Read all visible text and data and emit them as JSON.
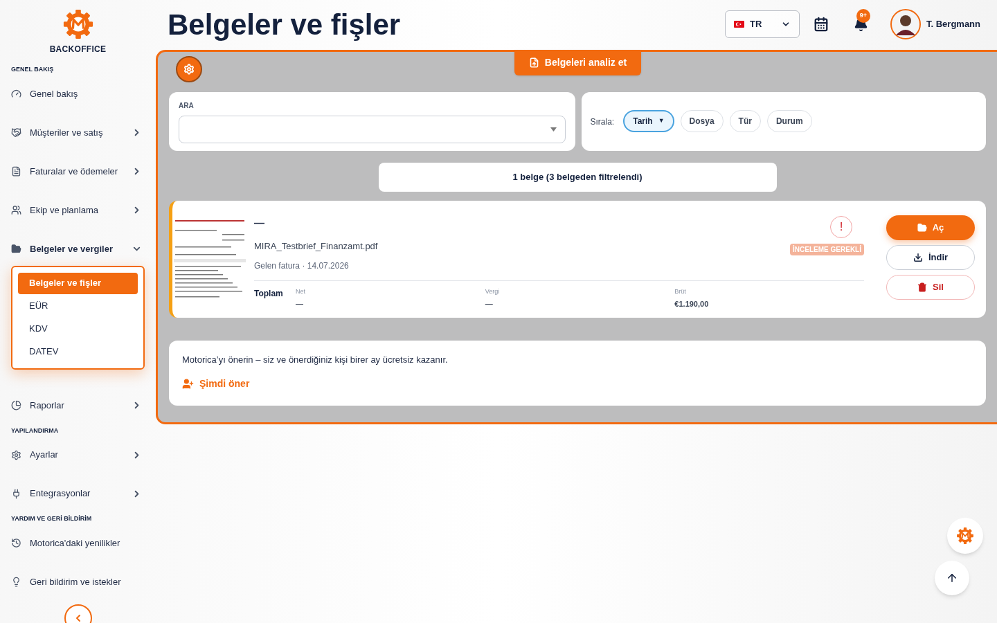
{
  "sidebar": {
    "brand": "BACKOFFICE",
    "sections": [
      {
        "heading": "GENEL BAKIŞ",
        "items": [
          {
            "label": "Genel bakış"
          },
          {
            "label": "Müşteriler ve satış",
            "expanded": false
          },
          {
            "label": "Faturalar ve ödemeler",
            "expanded": false
          },
          {
            "label": "Ekip ve planlama",
            "expanded": false
          },
          {
            "label": "Belgeler ve vergiler",
            "expanded": true,
            "children": [
              {
                "label": "Belgeler ve fişler",
                "selected": true
              },
              {
                "label": "EÜR",
                "selected": false
              },
              {
                "label": "KDV",
                "selected": false
              },
              {
                "label": "DATEV",
                "selected": false
              }
            ]
          },
          {
            "label": "Raporlar",
            "expanded": false
          }
        ]
      },
      {
        "heading": "YAPILANDIRMA",
        "items": [
          {
            "label": "Ayarlar",
            "expanded": false
          },
          {
            "label": "Entegrasyonlar",
            "expanded": false
          }
        ]
      },
      {
        "heading": "YARDIM VE GERİ BİLDİRİM",
        "items": [
          {
            "label": "Motorica'daki yenilikler"
          },
          {
            "label": "Geri bildirim ve istekler"
          }
        ]
      }
    ]
  },
  "header": {
    "title": "Belgeler ve fişler",
    "language": "TR",
    "notification_count": "9+",
    "user_name": "T. Bergmann"
  },
  "panel": {
    "analyze_button": "Belgeleri analiz et",
    "search": {
      "label": "ARA"
    },
    "sort": {
      "label": "Sırala:",
      "options": [
        {
          "label": "Tarih",
          "selected": true,
          "indicator": "▼"
        },
        {
          "label": "Dosya",
          "selected": false
        },
        {
          "label": "Tür",
          "selected": false
        },
        {
          "label": "Durum",
          "selected": false
        }
      ]
    },
    "result_count": "1 belge (3 belgeden filtrelendi)",
    "documents": [
      {
        "title": "—",
        "filename": "MIRA_Testbrief_Finanzamt.pdf",
        "meta": "Gelen fatura · 14.07.2026",
        "status_mark": "!",
        "badge": "İNCELEME GEREKLİ",
        "total_label": "Toplam",
        "amounts": [
          {
            "label": "Net",
            "value": "—"
          },
          {
            "label": "Vergi",
            "value": "—"
          },
          {
            "label": "Brüt",
            "value": "€1.190,00"
          }
        ],
        "actions": [
          {
            "kind": "primary",
            "label": "Aç"
          },
          {
            "kind": "download",
            "label": "İndir"
          },
          {
            "kind": "danger",
            "label": "Sil"
          }
        ]
      }
    ],
    "referral": {
      "text": "Motorica’yı önerin – siz ve önerdiğiniz kişi birer ay ücretsiz kazanır.",
      "link": "Şimdi öner"
    }
  }
}
